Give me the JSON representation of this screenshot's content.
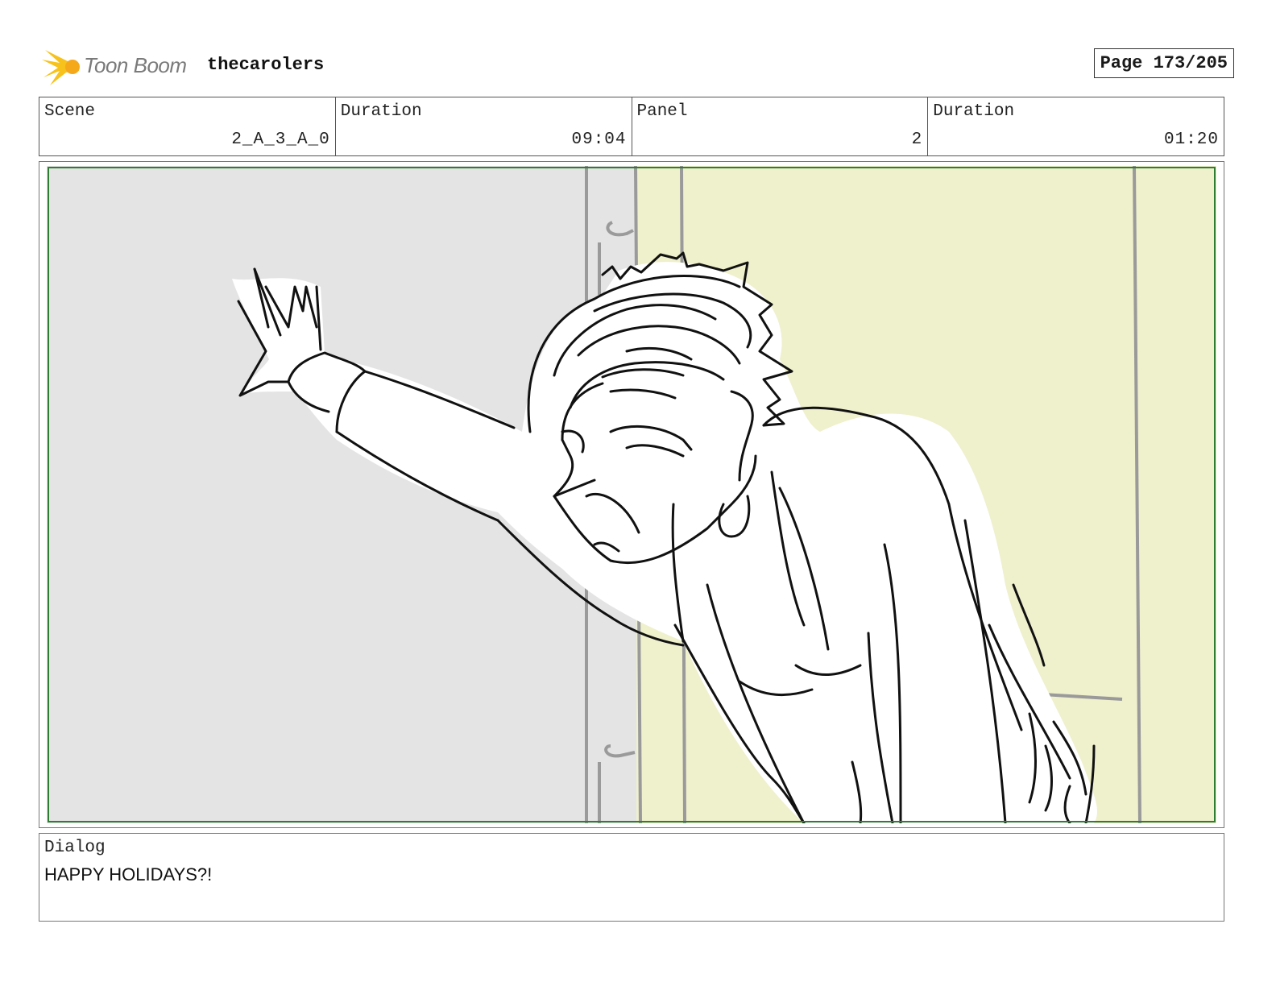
{
  "header": {
    "logo_text": "Toon Boom",
    "project_title": "thecarolers",
    "page_label": "Page 173/205"
  },
  "info": {
    "scene": {
      "label": "Scene",
      "value": "2_A_3_A_0"
    },
    "scene_duration": {
      "label": "Duration",
      "value": "09:04"
    },
    "panel": {
      "label": "Panel",
      "value": "2"
    },
    "panel_duration": {
      "label": "Duration",
      "value": "01:20"
    }
  },
  "dialog": {
    "label": "Dialog",
    "text": "HAPPY HOLIDAYS?!"
  },
  "colors": {
    "safe_frame": "#2e7d32",
    "background_left": "#e4e4e4",
    "background_right": "#eff0cc"
  }
}
